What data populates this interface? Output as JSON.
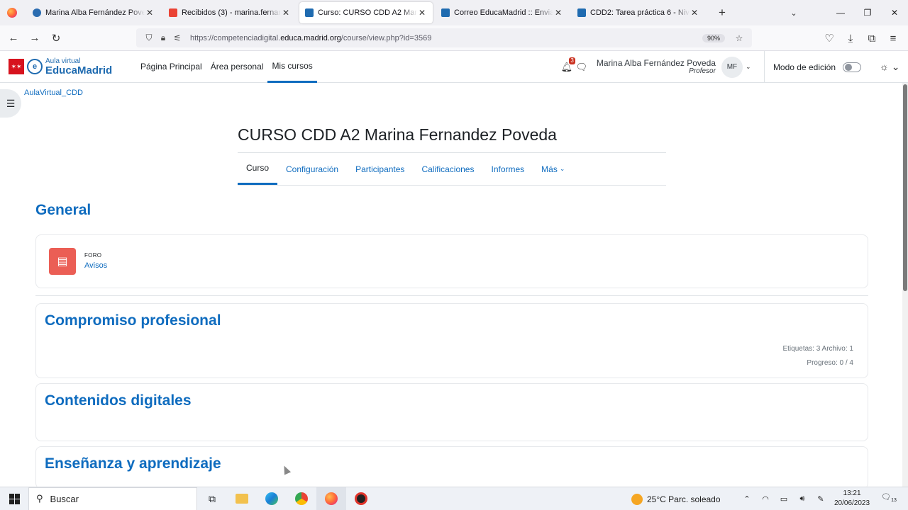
{
  "browser": {
    "tabs": [
      {
        "title": "Marina Alba Fernández Poveda",
        "active": false
      },
      {
        "title": "Recibidos (3) - marina.fernandez",
        "active": false
      },
      {
        "title": "Curso: CURSO CDD A2 Marina F",
        "active": true
      },
      {
        "title": "Correo EducaMadrid :: Enviados",
        "active": false
      },
      {
        "title": "CDD2: Tarea práctica 6 - Nivel A",
        "active": false
      }
    ],
    "url_prefix": "https://competenciadigital.",
    "url_domain": "educa.madrid.org",
    "url_path": "/course/view.php?id=3569",
    "zoom": "90%"
  },
  "header": {
    "logo_small": "Aula virtual",
    "logo_big": "EducaMadrid",
    "nav": [
      "Página Principal",
      "Área personal",
      "Mis cursos"
    ],
    "notifications_count": "3",
    "user_name": "Marina Alba Fernández Poveda",
    "user_role": "Profesor",
    "avatar_initials": "MF",
    "edit_mode_label": "Modo de edición"
  },
  "breadcrumb": "AulaVirtual_CDD",
  "course": {
    "title": "CURSO CDD A2 Marina Fernandez Poveda",
    "tabs": [
      "Curso",
      "Configuración",
      "Participantes",
      "Calificaciones",
      "Informes",
      "Más"
    ]
  },
  "sections": {
    "general_title": "General",
    "forum_type": "FORO",
    "forum_name": "Avisos",
    "s1_title": "Compromiso profesional",
    "s1_meta1": "Etiquetas: 3   Archivo: 1",
    "s1_meta2": "Progreso: 0 / 4",
    "s2_title": "Contenidos digitales",
    "s3_title": "Enseñanza y aprendizaje"
  },
  "taskbar": {
    "search_placeholder": "Buscar",
    "weather": "25°C  Parc. soleado",
    "time": "13:21",
    "date": "20/06/2023",
    "notification_count": "13"
  }
}
